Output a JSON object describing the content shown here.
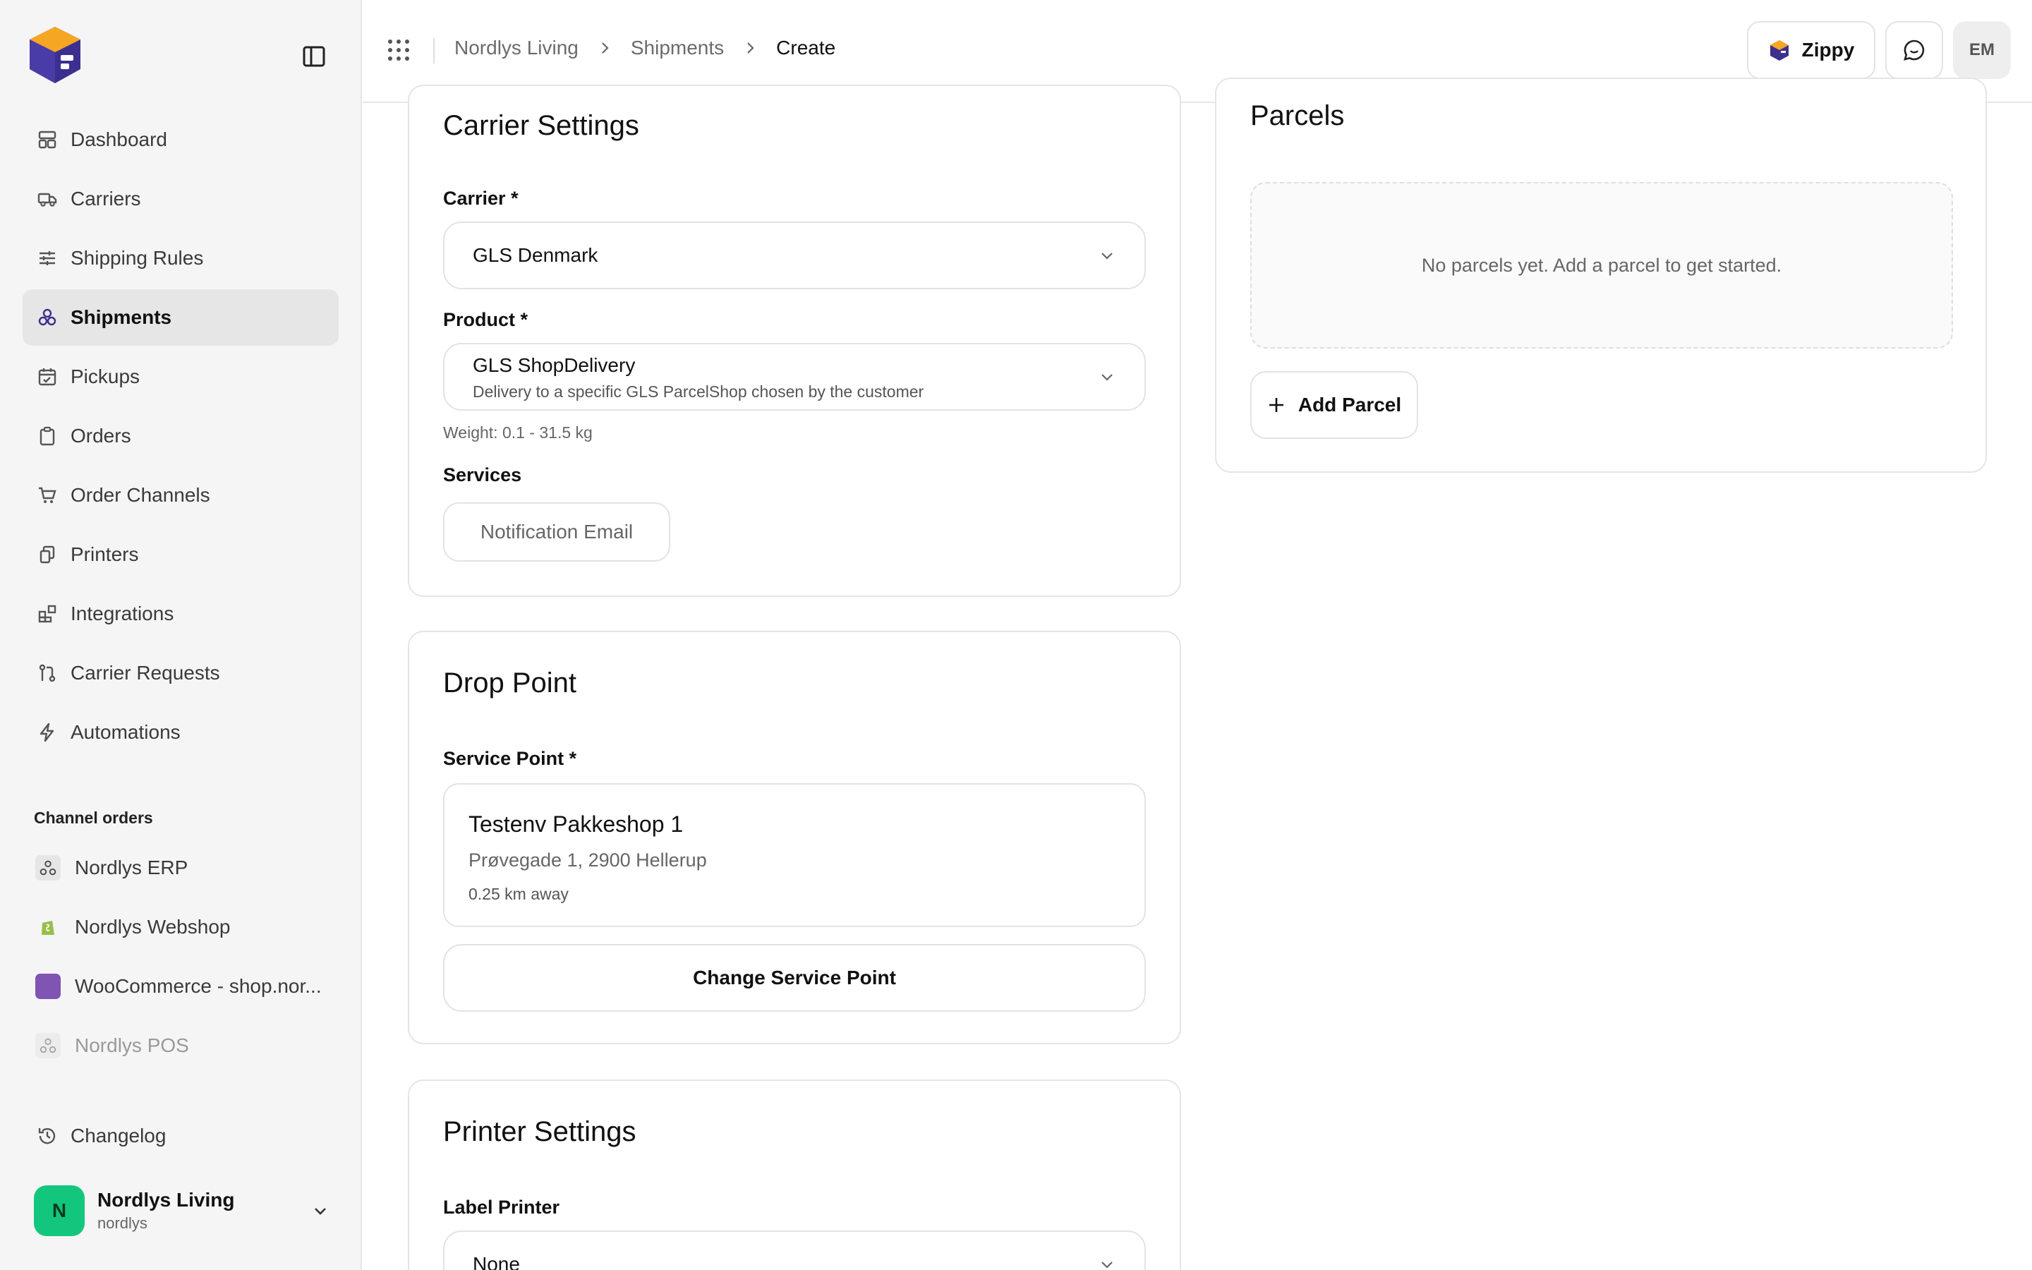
{
  "sidebar": {
    "nav": [
      {
        "label": "Dashboard",
        "icon": "dashboard-icon"
      },
      {
        "label": "Carriers",
        "icon": "truck-icon"
      },
      {
        "label": "Shipping Rules",
        "icon": "sliders-icon"
      },
      {
        "label": "Shipments",
        "icon": "shipments-icon",
        "active": true
      },
      {
        "label": "Pickups",
        "icon": "calendar-check-icon"
      },
      {
        "label": "Orders",
        "icon": "clipboard-icon"
      },
      {
        "label": "Order Channels",
        "icon": "cart-icon"
      },
      {
        "label": "Printers",
        "icon": "printer-icon"
      },
      {
        "label": "Integrations",
        "icon": "blocks-icon"
      },
      {
        "label": "Carrier Requests",
        "icon": "git-pull-icon"
      },
      {
        "label": "Automations",
        "icon": "bolt-icon"
      }
    ],
    "channel_section_label": "Channel orders",
    "channels": [
      {
        "label": "Nordlys ERP",
        "icon": "webhook-icon"
      },
      {
        "label": "Nordlys Webshop",
        "icon": "shopify-icon"
      },
      {
        "label": "WooCommerce - shop.nor...",
        "icon": "woocommerce-icon"
      },
      {
        "label": "Nordlys POS",
        "icon": "webhook-icon",
        "muted": true
      }
    ],
    "changelog_label": "Changelog",
    "account": {
      "initial": "N",
      "name": "Nordlys Living",
      "slug": "nordlys"
    }
  },
  "header": {
    "breadcrumbs": [
      "Nordlys Living",
      "Shipments",
      "Create"
    ],
    "zippy_label": "Zippy",
    "user_initials": "EM"
  },
  "carrier_settings": {
    "title": "Carrier Settings",
    "carrier_label": "Carrier *",
    "carrier_value": "GLS Denmark",
    "product_label": "Product *",
    "product_value": "GLS ShopDelivery",
    "product_description": "Delivery to a specific GLS ParcelShop chosen by the customer",
    "weight_hint": "Weight: 0.1 - 31.5 kg",
    "services_label": "Services",
    "service_button": "Notification Email"
  },
  "drop_point": {
    "title": "Drop Point",
    "service_point_label": "Service Point *",
    "point_name": "Testenv Pakkeshop 1",
    "point_address": "Prøvegade 1, 2900 Hellerup",
    "point_distance": "0.25 km away",
    "change_button": "Change Service Point"
  },
  "printer_settings": {
    "title": "Printer Settings",
    "label_printer_label": "Label Printer",
    "label_printer_value": "None"
  },
  "parcels": {
    "title": "Parcels",
    "empty_text": "No parcels yet. Add a parcel to get started.",
    "add_button": "Add Parcel"
  },
  "colors": {
    "accent_green": "#12c77d",
    "sidebar_bg": "#f5f5f5",
    "active_bg": "#e6e6e6",
    "logo_orange": "#f5a623",
    "logo_purple": "#3b2f8f"
  }
}
